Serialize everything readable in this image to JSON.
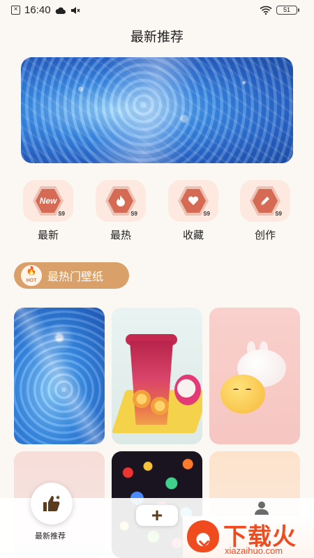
{
  "status_bar": {
    "time": "16:40",
    "battery": "51",
    "icons": [
      "close-notification-icon",
      "cloud-icon",
      "mute-icon",
      "wifi-icon",
      "battery-icon"
    ]
  },
  "header": {
    "title": "最新推荐"
  },
  "categories": [
    {
      "label": "最新",
      "icon": "new-icon",
      "icon_text": "New",
      "badge": "S9"
    },
    {
      "label": "最热",
      "icon": "flame-icon",
      "badge": "S9"
    },
    {
      "label": "收藏",
      "icon": "heart-icon",
      "badge": "S9"
    },
    {
      "label": "创作",
      "icon": "pencil-icon",
      "badge": "S9"
    }
  ],
  "hot_section": {
    "label": "最热门壁纸",
    "badge": "HOT"
  },
  "bottom_nav": {
    "home_label": "最新推荐",
    "add_symbol": "+"
  },
  "watermark": {
    "title": "下载火",
    "subtitle": "xiazaihuo.com"
  },
  "colors": {
    "accent": "#d9a06a",
    "tile_bg": "#fde9e0",
    "icon_red": "#d56a55",
    "watermark": "#ef4b1f"
  }
}
